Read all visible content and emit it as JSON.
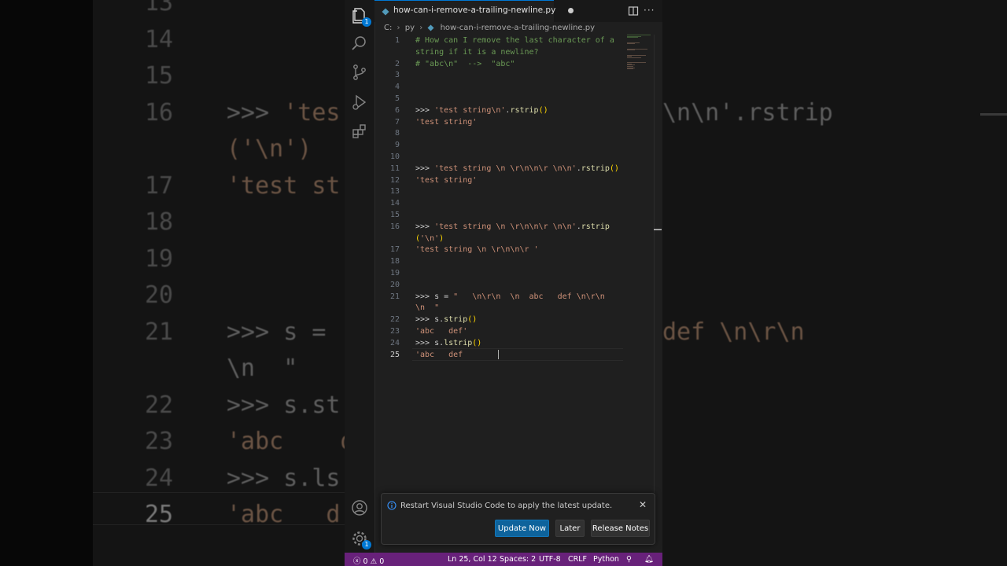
{
  "background_zoom": {
    "lines": [
      {
        "num": "13",
        "text": ""
      },
      {
        "num": "14",
        "text": ""
      },
      {
        "num": "15",
        "text": ""
      },
      {
        "num": "16",
        "prefix": ">>> ",
        "str": "'tes",
        "tail": "\\n\\n'.rstrip"
      },
      {
        "num": "",
        "str": "('\\n')"
      },
      {
        "num": "17",
        "str": "'test st"
      },
      {
        "num": "18",
        "text": ""
      },
      {
        "num": "19",
        "text": ""
      },
      {
        "num": "20",
        "text": ""
      },
      {
        "num": "21",
        "prefix": ">>> s =",
        "tail": "def \\n\\r\\n"
      },
      {
        "num": "",
        "prefix": "\\n  \""
      },
      {
        "num": "22",
        "prefix": ">>> s.st"
      },
      {
        "num": "23",
        "str": "'abc    d"
      },
      {
        "num": "24",
        "prefix": ">>> s.ls"
      },
      {
        "num": "25",
        "str": "'abc   d"
      }
    ]
  },
  "tab": {
    "title": "how-can-i-remove-a-trailing-newline.py",
    "modified": true
  },
  "breadcrumb": {
    "items": [
      "C:",
      "py",
      "how-can-i-remove-a-trailing-newline.py"
    ]
  },
  "editor": {
    "current_line": "25",
    "lines": [
      {
        "num": "1",
        "segments": [
          {
            "t": "# How can I remove the last character of a",
            "c": "comment"
          }
        ]
      },
      {
        "num": "",
        "segments": [
          {
            "t": "string if it is a newline?",
            "c": "comment"
          }
        ]
      },
      {
        "num": "2",
        "segments": [
          {
            "t": "# \"abc\\n\"  -->  \"abc\"",
            "c": "comment"
          }
        ]
      },
      {
        "num": "3",
        "segments": []
      },
      {
        "num": "4",
        "segments": []
      },
      {
        "num": "5",
        "segments": []
      },
      {
        "num": "6",
        "segments": [
          {
            "t": ">>> ",
            "c": "txt"
          },
          {
            "t": "'test string\\n'",
            "c": "str"
          },
          {
            "t": ".",
            "c": "txt"
          },
          {
            "t": "rstrip",
            "c": "fn"
          },
          {
            "t": "()",
            "c": "br"
          }
        ]
      },
      {
        "num": "7",
        "segments": [
          {
            "t": "'test string'",
            "c": "str"
          }
        ]
      },
      {
        "num": "8",
        "segments": []
      },
      {
        "num": "9",
        "segments": []
      },
      {
        "num": "10",
        "segments": []
      },
      {
        "num": "11",
        "segments": [
          {
            "t": ">>> ",
            "c": "txt"
          },
          {
            "t": "'test string \\n \\r\\n\\n\\r \\n\\n'",
            "c": "str"
          },
          {
            "t": ".",
            "c": "txt"
          },
          {
            "t": "rstrip",
            "c": "fn"
          },
          {
            "t": "()",
            "c": "br"
          }
        ]
      },
      {
        "num": "12",
        "segments": [
          {
            "t": "'test string'",
            "c": "str"
          }
        ]
      },
      {
        "num": "13",
        "segments": []
      },
      {
        "num": "14",
        "segments": []
      },
      {
        "num": "15",
        "segments": []
      },
      {
        "num": "16",
        "segments": [
          {
            "t": ">>> ",
            "c": "txt"
          },
          {
            "t": "'test string \\n \\r\\n\\n\\r \\n\\n'",
            "c": "str"
          },
          {
            "t": ".",
            "c": "txt"
          },
          {
            "t": "rstrip",
            "c": "fn"
          }
        ]
      },
      {
        "num": "",
        "segments": [
          {
            "t": "(",
            "c": "br"
          },
          {
            "t": "'\\n'",
            "c": "str"
          },
          {
            "t": ")",
            "c": "br"
          }
        ]
      },
      {
        "num": "17",
        "segments": [
          {
            "t": "'test string \\n \\r\\n\\n\\r '",
            "c": "str"
          }
        ]
      },
      {
        "num": "18",
        "segments": []
      },
      {
        "num": "19",
        "segments": []
      },
      {
        "num": "20",
        "segments": []
      },
      {
        "num": "21",
        "segments": [
          {
            "t": ">>> s = ",
            "c": "txt"
          },
          {
            "t": "\"   \\n\\r\\n  \\n  abc   def \\n\\r\\n",
            "c": "str"
          }
        ]
      },
      {
        "num": "",
        "segments": [
          {
            "t": "\\n  \"",
            "c": "str"
          }
        ]
      },
      {
        "num": "22",
        "segments": [
          {
            "t": ">>> s.",
            "c": "txt"
          },
          {
            "t": "strip",
            "c": "fn"
          },
          {
            "t": "()",
            "c": "br"
          }
        ]
      },
      {
        "num": "23",
        "segments": [
          {
            "t": "'abc   def'",
            "c": "str"
          }
        ]
      },
      {
        "num": "24",
        "segments": [
          {
            "t": ">>> s.",
            "c": "txt"
          },
          {
            "t": "lstrip",
            "c": "fn"
          },
          {
            "t": "()",
            "c": "br"
          }
        ]
      },
      {
        "num": "25",
        "segments": [
          {
            "t": "'abc   def ",
            "c": "str"
          }
        ]
      }
    ]
  },
  "notification": {
    "message": "Restart Visual Studio Code to apply the latest update.",
    "buttons": {
      "update": "Update Now",
      "later": "Later",
      "notes": "Release Notes"
    }
  },
  "statusbar": {
    "errors": "0",
    "warnings": "0",
    "position": "Ln 25, Col 12",
    "spaces": "Spaces: 2",
    "encoding": "UTF-8",
    "eol": "CRLF",
    "language": "Python"
  },
  "activity": {
    "explorer_badge": "1",
    "settings_badge": "1"
  },
  "colors": {
    "statusbar": "#68217a",
    "accent": "#0078d4",
    "comment": "#6a9955",
    "string": "#ce9178",
    "function": "#dcdcaa",
    "bracket": "#ffd700"
  }
}
